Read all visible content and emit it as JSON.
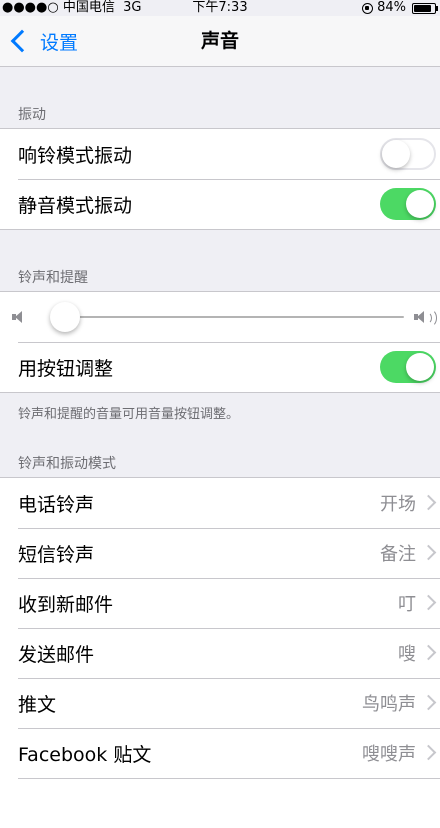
{
  "status_bar": {
    "carrier": "●●●●○ 中国电信",
    "network": "3G",
    "time": "下午7:33",
    "battery": "84%",
    "battery_level": 0.84
  },
  "nav": {
    "back_label": "设置",
    "title": "声音"
  },
  "vibration": {
    "header": "振动",
    "rows": [
      {
        "label": "响铃模式振动",
        "on": false
      },
      {
        "label": "静音模式振动",
        "on": true
      }
    ]
  },
  "ringer": {
    "header": "铃声和提醒",
    "volume_level": 0.0,
    "button_adjust": {
      "label": "用按钮调整",
      "on": true
    },
    "footer": "铃声和提醒的音量可用音量按钮调整。"
  },
  "patterns": {
    "header": "铃声和振动模式",
    "rows": [
      {
        "label": "电话铃声",
        "value": "开场"
      },
      {
        "label": "短信铃声",
        "value": "备注"
      },
      {
        "label": "收到新邮件",
        "value": "叮"
      },
      {
        "label": "发送邮件",
        "value": "嗖"
      },
      {
        "label": "推文",
        "value": "鸟鸣声"
      },
      {
        "label": "Facebook 贴文",
        "value": "嗖嗖声"
      }
    ]
  },
  "colors": {
    "accent": "#007aff",
    "switch_on": "#4cd964",
    "background": "#efeff4"
  }
}
